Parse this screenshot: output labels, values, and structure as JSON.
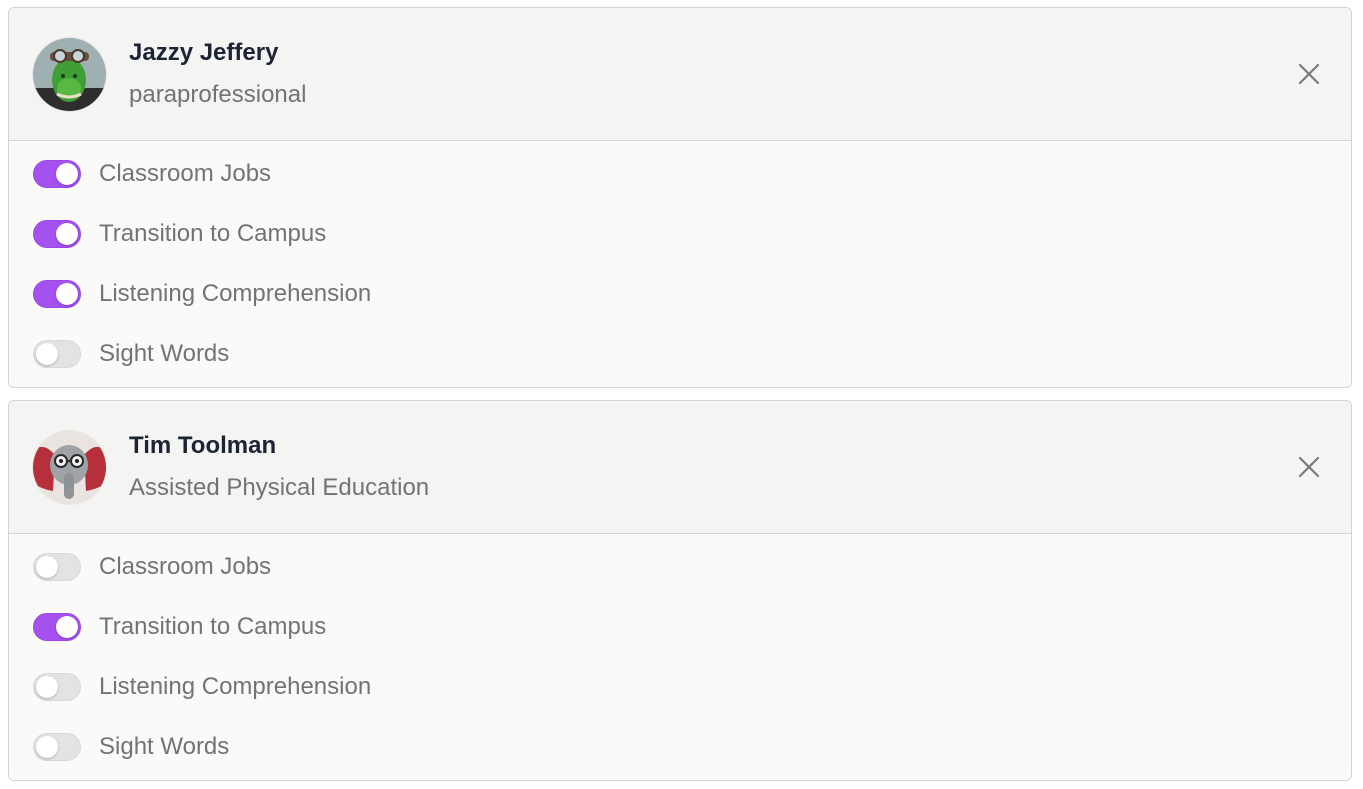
{
  "members": [
    {
      "name": "Jazzy Jeffery",
      "role": "paraprofessional",
      "avatar_icon": "lizard-pilot-avatar",
      "toggles": [
        {
          "label": "Classroom Jobs",
          "on": true
        },
        {
          "label": "Transition to Campus",
          "on": true
        },
        {
          "label": "Listening Comprehension",
          "on": true
        },
        {
          "label": "Sight Words",
          "on": false
        }
      ]
    },
    {
      "name": "Tim Toolman",
      "role": "Assisted Physical Education",
      "avatar_icon": "elephant-glasses-avatar",
      "toggles": [
        {
          "label": "Classroom Jobs",
          "on": false
        },
        {
          "label": "Transition to Campus",
          "on": true
        },
        {
          "label": "Listening Comprehension",
          "on": false
        },
        {
          "label": "Sight Words",
          "on": false
        }
      ]
    }
  ],
  "colors": {
    "toggle_on": "#a451f0",
    "toggle_off": "#e3e3e3",
    "name_text": "#1c2333",
    "secondary_text": "#737373"
  },
  "icons": {
    "close": "close-icon"
  }
}
